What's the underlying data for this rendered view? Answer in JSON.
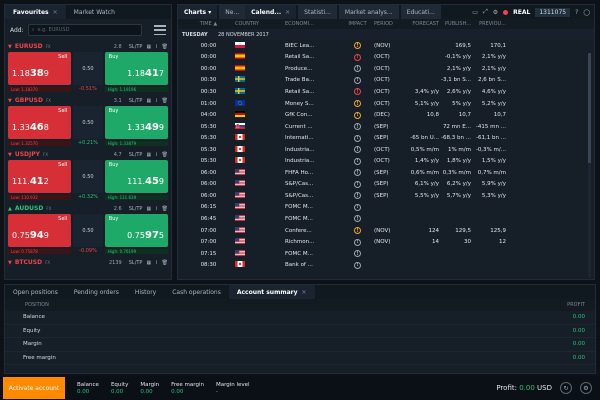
{
  "left_tabs": [
    {
      "label": "Favourites"
    },
    {
      "label": "Market Watch"
    }
  ],
  "add_label": "Add:",
  "search_placeholder": "e.g. EURUSD",
  "instruments": [
    {
      "symbol": "EURUSD",
      "dir": "down",
      "fx": "FX",
      "spread": "2.8",
      "sell_a": "1.18",
      "sell_b": "38",
      "sell_c": "9",
      "buy_a": "1.18",
      "buy_b": "41",
      "buy_c": "7",
      "mid": "0.50",
      "low": "Low: 1.18370",
      "chg": "-0.51%",
      "chg_dir": "neg",
      "high": "High: 1.19196"
    },
    {
      "symbol": "GBPUSD",
      "dir": "down",
      "fx": "FX",
      "spread": "3.1",
      "sell_a": "1.33",
      "sell_b": "46",
      "sell_c": "8",
      "buy_a": "1.33",
      "buy_b": "49",
      "buy_c": "9",
      "mid": "0.50",
      "low": "Low: 1.32570",
      "chg": "+0.21%",
      "chg_dir": "pos",
      "high": "High: 1.33879"
    },
    {
      "symbol": "USDJPY",
      "dir": "down",
      "fx": "FX",
      "spread": "4.7",
      "sell_a": "111.",
      "sell_b": "41",
      "sell_c": "2",
      "buy_a": "111.",
      "buy_b": "45",
      "buy_c": "9",
      "mid": "0.50",
      "low": "Low: 110.932",
      "chg": "+0.32%",
      "chg_dir": "pos",
      "high": "High: 111.639"
    },
    {
      "symbol": "AUDUSD",
      "dir": "up",
      "fx": "FX",
      "spread": "2.6",
      "sell_a": "0.75",
      "sell_b": "94",
      "sell_c": "9",
      "buy_a": "0.75",
      "buy_b": "97",
      "buy_c": "5",
      "mid": "0.50",
      "low": "Low: 0.75878",
      "chg": "-0.09%",
      "chg_dir": "neg",
      "high": "High: 0.76199"
    },
    {
      "symbol": "BTCUSD",
      "dir": "down",
      "fx": "FX",
      "spread": "2139"
    }
  ],
  "right_tabs": [
    {
      "label": "Charts ▾"
    },
    {
      "label": "Ne..."
    },
    {
      "label": "Calend..."
    },
    {
      "label": "Statisti..."
    },
    {
      "label": "Market analys..."
    },
    {
      "label": "Educati..."
    }
  ],
  "account": {
    "mode": "REAL",
    "number": "1311075"
  },
  "calendar": {
    "headers": {
      "time": "TIME ▲",
      "country": "COUNTRY",
      "economic": "ECONOMI...",
      "impact": "IMPACT",
      "period": "PERIOD",
      "forecast": "FORECAST",
      "published": "PUBLISH...",
      "previous": "PREVIOU..."
    },
    "day": "TUESDAY",
    "date": "28 NOVEMBER 2017",
    "rows": [
      {
        "time": "00:00",
        "flag": "pl",
        "event": "BIEC Lea...",
        "impact": "m",
        "period": "(NOV)",
        "forecast": "",
        "published": "169,5",
        "previous": "170,1"
      },
      {
        "time": "00:00",
        "flag": "es",
        "event": "Retail Sa...",
        "impact": "h",
        "period": "(OCT)",
        "forecast": "",
        "published": "-0,1% y/y",
        "previous": "2,1% y/y"
      },
      {
        "time": "00:00",
        "flag": "es",
        "event": "Produce...",
        "impact": "l",
        "period": "(OCT)",
        "forecast": "",
        "published": "2,1% y/y",
        "previous": "2,1% y/y"
      },
      {
        "time": "00:30",
        "flag": "se",
        "event": "Trade Ba...",
        "impact": "l",
        "period": "(OCT)",
        "forecast": "",
        "published": "-3,1 bn S...",
        "previous": "2,6 bn S..."
      },
      {
        "time": "00:30",
        "flag": "se",
        "event": "Retail Sa...",
        "impact": "h",
        "period": "(OCT)",
        "forecast": "3,4% y/y",
        "published": "2,6% y/y",
        "previous": "4,6% y/y"
      },
      {
        "time": "01:00",
        "flag": "eu",
        "event": "Money S...",
        "impact": "m",
        "period": "(OCT)",
        "forecast": "5,1% y/y",
        "published": "5% y/y",
        "previous": "5,2% y/y"
      },
      {
        "time": "04:00",
        "flag": "de",
        "event": "GfK Con...",
        "impact": "m",
        "period": "(DEC)",
        "forecast": "10,8",
        "published": "10,7",
        "previous": "10,7"
      },
      {
        "time": "05:30",
        "flag": "sk",
        "event": "Current ...",
        "impact": "l",
        "period": "(SEP)",
        "forecast": "",
        "published": "72 mn E...",
        "previous": "-415 mn ..."
      },
      {
        "time": "05:30",
        "flag": "ca",
        "event": "Internati...",
        "impact": "l",
        "period": "(SEP)",
        "forecast": "-65 bn U...",
        "published": "-68,3 bn ...",
        "previous": "-61,1 bn ..."
      },
      {
        "time": "05:30",
        "flag": "ca",
        "event": "Industria...",
        "impact": "l",
        "period": "(OCT)",
        "forecast": "0,5% m/m",
        "published": "1% m/m",
        "previous": "-0,3% m/..."
      },
      {
        "time": "05:30",
        "flag": "ca",
        "event": "Industria...",
        "impact": "l",
        "period": "(OCT)",
        "forecast": "1,4% y/y",
        "published": "1,8% y/y",
        "previous": "1,5% y/y"
      },
      {
        "time": "06:00",
        "flag": "us",
        "event": "FHFA Ho...",
        "impact": "l",
        "period": "(SEP)",
        "forecast": "0,6% m/m",
        "published": "0,3% m/m",
        "previous": "0,7% m/m"
      },
      {
        "time": "06:00",
        "flag": "us",
        "event": "S&P/Cas...",
        "impact": "l",
        "period": "(SEP)",
        "forecast": "6,1% y/y",
        "published": "6,2% y/y",
        "previous": "5,9% y/y"
      },
      {
        "time": "06:00",
        "flag": "us",
        "event": "S&P/Cas...",
        "impact": "l",
        "period": "(SEP)",
        "forecast": "5,5% y/y",
        "published": "5,7% y/y",
        "previous": "5,3% y/y"
      },
      {
        "time": "06:15",
        "flag": "us",
        "event": "FOMC M...",
        "impact": "l",
        "period": "",
        "forecast": "",
        "published": "",
        "previous": ""
      },
      {
        "time": "06:45",
        "flag": "us",
        "event": "FOMC M...",
        "impact": "l",
        "period": "",
        "forecast": "",
        "published": "",
        "previous": ""
      },
      {
        "time": "07:00",
        "flag": "us",
        "event": "Confere...",
        "impact": "m",
        "period": "(NOV)",
        "forecast": "124",
        "published": "129,5",
        "previous": "125,9"
      },
      {
        "time": "07:00",
        "flag": "us",
        "event": "Richmon...",
        "impact": "l",
        "period": "(NOV)",
        "forecast": "14",
        "published": "30",
        "previous": "12"
      },
      {
        "time": "07:15",
        "flag": "us",
        "event": "FOMC M...",
        "impact": "l",
        "period": "",
        "forecast": "",
        "published": "",
        "previous": ""
      },
      {
        "time": "08:30",
        "flag": "ca",
        "event": "Bank of ...",
        "impact": "l",
        "period": "",
        "forecast": "",
        "published": "",
        "previous": ""
      }
    ]
  },
  "bottom_tabs": [
    {
      "label": "Open positions"
    },
    {
      "label": "Pending orders"
    },
    {
      "label": "History"
    },
    {
      "label": "Cash operations"
    },
    {
      "label": "Account summary"
    }
  ],
  "summary": {
    "col_position": "POSITION",
    "col_profit": "PROFIT",
    "rows": [
      {
        "label": "Balance",
        "value": "0.00"
      },
      {
        "label": "Equity",
        "value": "0.00"
      },
      {
        "label": "Margin",
        "value": "0.00"
      },
      {
        "label": "Free margin",
        "value": "0.00"
      }
    ]
  },
  "status": {
    "activate": "Activate account",
    "items": [
      {
        "k": "Balance",
        "v": "0.00"
      },
      {
        "k": "Equity",
        "v": "0.00"
      },
      {
        "k": "Margin",
        "v": "0.00"
      },
      {
        "k": "Free margin",
        "v": "0.00"
      },
      {
        "k": "Margin level",
        "v": "-"
      }
    ],
    "profit_label": "Profit:",
    "profit_value": "0.00",
    "currency": "USD"
  },
  "colors": {
    "sell": "#d72f38",
    "buy": "#1fa968",
    "accent": "#ff8a00",
    "positive": "#28c37a",
    "negative": "#f0434b"
  }
}
